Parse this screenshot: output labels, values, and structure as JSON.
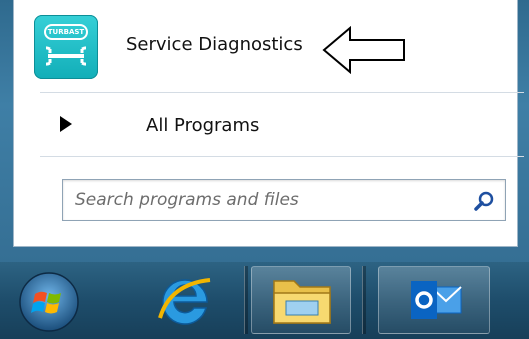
{
  "start_menu": {
    "pinned_item": {
      "label": "Service Diagnostics",
      "icon": "wrench-tool-icon",
      "icon_badge_text": "TURBAST"
    },
    "all_programs_label": "All Programs",
    "search": {
      "placeholder": "Search programs and files",
      "value": ""
    }
  },
  "taskbar": {
    "items": [
      {
        "name": "start-orb",
        "icon": "windows-logo-icon"
      },
      {
        "name": "internet-explorer",
        "icon": "internet-explorer-icon"
      },
      {
        "name": "windows-explorer",
        "icon": "folder-icon"
      },
      {
        "name": "outlook",
        "icon": "outlook-icon"
      }
    ]
  },
  "colors": {
    "menu_frame": "#3f7fa6",
    "taskbar": "#1e4d6b",
    "app_icon": "#12aeb8",
    "outlook": "#0a64c2"
  }
}
